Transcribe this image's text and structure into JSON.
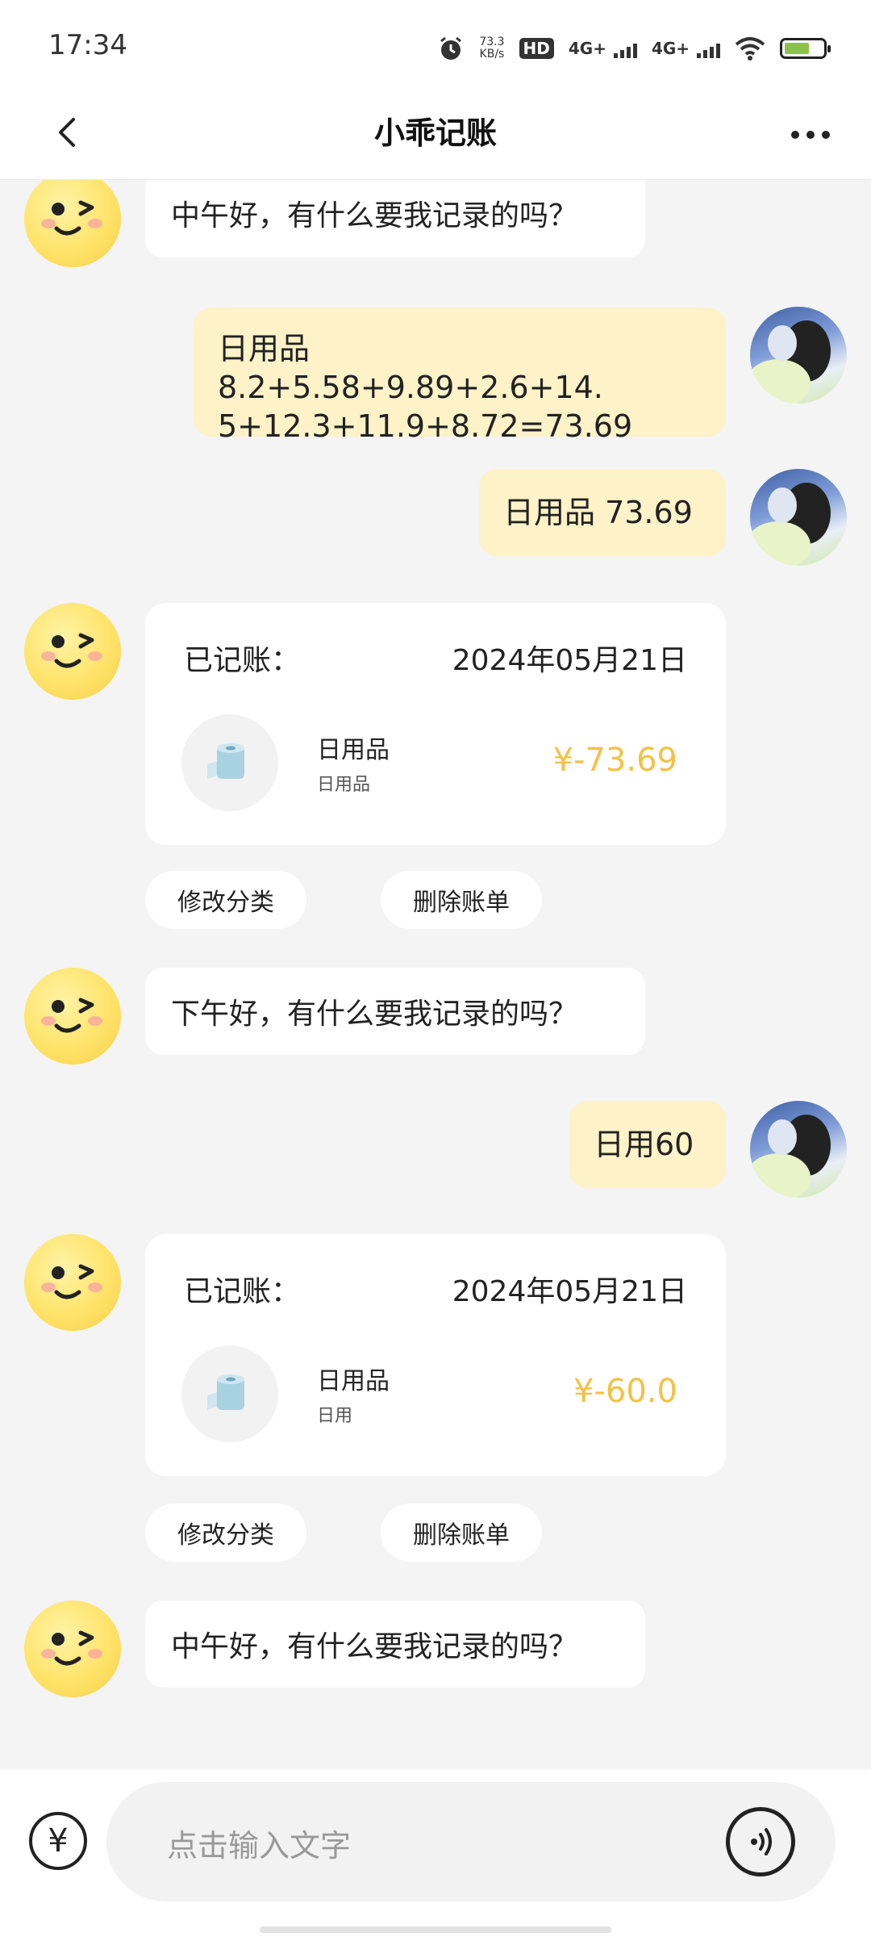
{
  "status_bar": {
    "time": "17:34",
    "speed_value": "73.3",
    "speed_unit": "KB/s",
    "hd_label": "HD",
    "net1": "4G+",
    "net2": "4G+"
  },
  "header": {
    "title": "小乖记账",
    "back_icon": "chevron-left-icon",
    "more_icon": "more-dots-icon"
  },
  "messages": [
    {
      "type": "bot_text",
      "text": "中午好，有什么要我记录的吗？"
    },
    {
      "type": "user_text",
      "lines": [
        "日用品 8.2+5.58+9.89+2.6+14.",
        "5+12.3+11.9+8.72=73.69"
      ]
    },
    {
      "type": "user_text",
      "text": "日用品 73.69"
    },
    {
      "type": "bot_card",
      "label": "已记账：",
      "date": "2024年05月21日",
      "category": "日用品",
      "note": "日用品",
      "amount": "¥-73.69",
      "icon": "toilet-paper-icon"
    },
    {
      "type": "actions",
      "buttons": [
        "修改分类",
        "删除账单"
      ]
    },
    {
      "type": "bot_text",
      "text": "下午好，有什么要我记录的吗？"
    },
    {
      "type": "user_text",
      "text": "日用60"
    },
    {
      "type": "bot_card",
      "label": "已记账：",
      "date": "2024年05月21日",
      "category": "日用品",
      "note": "日用",
      "amount": "¥-60.0",
      "icon": "toilet-paper-icon"
    },
    {
      "type": "actions",
      "buttons": [
        "修改分类",
        "删除账单"
      ]
    },
    {
      "type": "bot_text",
      "text": "中午好，有什么要我记录的吗？"
    }
  ],
  "input_bar": {
    "currency_symbol": "¥",
    "placeholder": "点击输入文字",
    "voice_icon": "voice-icon"
  },
  "colors": {
    "accent_amount": "#f3c145",
    "user_bubble": "#fdf2c8",
    "bot_avatar": "#ffe36a"
  }
}
